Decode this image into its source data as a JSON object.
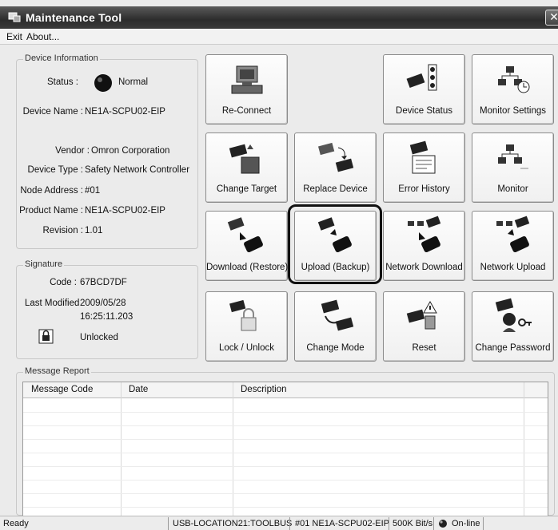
{
  "window": {
    "title": "Maintenance Tool"
  },
  "menu": {
    "exit": "Exit",
    "about": "About..."
  },
  "device_info": {
    "legend": "Device Information",
    "status_label": "Status :",
    "status_value": "Normal",
    "device_name_label": "Device Name :",
    "device_name": "NE1A-SCPU02-EIP",
    "vendor_label": "Vendor :",
    "vendor": "Omron Corporation",
    "device_type_label": "Device Type :",
    "device_type": "Safety Network Controller",
    "node_address_label": "Node Address :",
    "node_address": "#01",
    "product_name_label": "Product Name :",
    "product_name": "NE1A-SCPU02-EIP",
    "revision_label": "Revision :",
    "revision": "1.01"
  },
  "signature": {
    "legend": "Signature",
    "code_label": "Code :",
    "code": "67BCD7DF",
    "last_modified_label": "Last Modified",
    "last_modified_date": "2009/05/28",
    "last_modified_time": "16:25:11.203",
    "lock_state": "Unlocked"
  },
  "buttons": {
    "reconnect": "Re-Connect",
    "device_status": "Device Status",
    "monitor_settings": "Monitor Settings",
    "change_target": "Change Target",
    "replace_device": "Replace Device",
    "error_history": "Error History",
    "monitor": "Monitor",
    "download_restore": "Download (Restore)",
    "upload_backup": "Upload (Backup)",
    "network_download": "Network Download",
    "network_upload": "Network Upload",
    "lock_unlock": "Lock / Unlock",
    "change_mode": "Change Mode",
    "reset": "Reset",
    "change_password": "Change Password"
  },
  "message_report": {
    "legend": "Message Report",
    "columns": [
      "Message Code",
      "Date",
      "Description"
    ]
  },
  "statusbar": {
    "state": "Ready",
    "connection": "USB-LOCATION21:TOOLBUS",
    "device": "#01 NE1A-SCPU02-EIP",
    "baud": "500K Bit/s",
    "online": "On-line"
  }
}
